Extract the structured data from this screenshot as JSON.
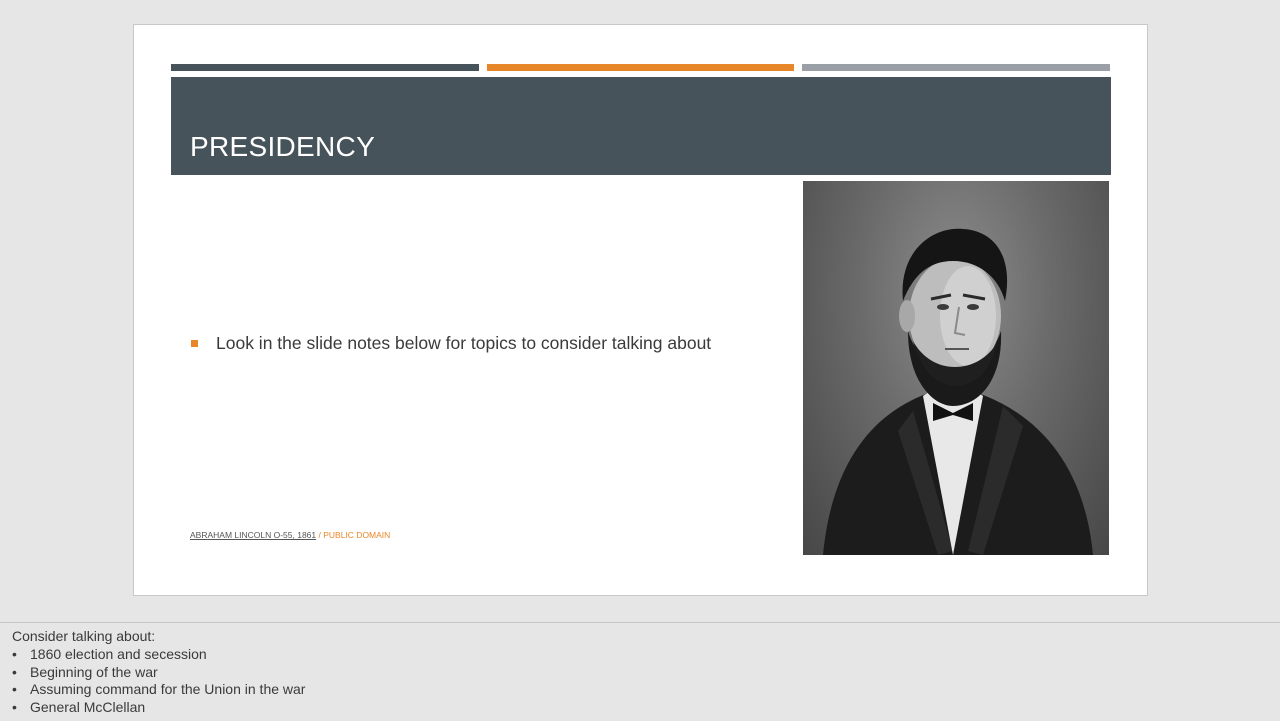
{
  "slide": {
    "title": "PRESIDENCY",
    "bullets": [
      "Look in the slide notes below for topics to consider talking about"
    ],
    "credit": {
      "link_text": "ABRAHAM LINCOLN O-55, 1861",
      "separator": " / ",
      "license": "PUBLIC DOMAIN"
    },
    "image": "portrait-photo"
  },
  "notes": {
    "heading": "Consider talking about:",
    "bullet_glyph": "•",
    "items": [
      "1860 election and secession",
      "Beginning of the war",
      "Assuming command for the Union in the war",
      "General McClellan"
    ]
  },
  "colors": {
    "accent": "#e8862a",
    "title_band": "#46535a",
    "bar_gray": "#9aa0a5",
    "background": "#e6e6e6"
  }
}
